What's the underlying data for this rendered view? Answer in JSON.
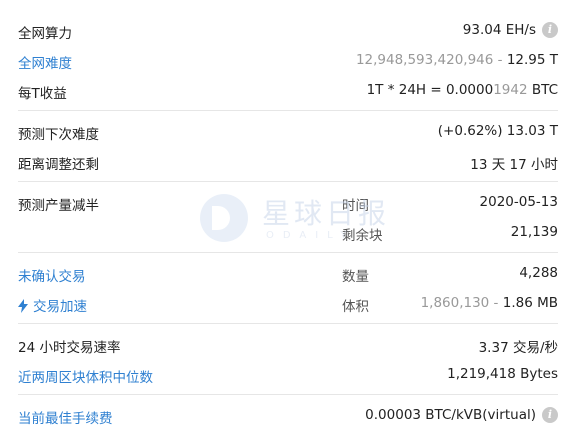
{
  "rows": {
    "hashrate": {
      "label": "全网算力",
      "value": "93.04 EH/s"
    },
    "difficulty": {
      "label": "全网难度",
      "value_gray": "12,948,593,420,946 - ",
      "value_dark": "12.95 T"
    },
    "revenue": {
      "label": "每T收益",
      "value_dark": "1T * 24H = 0.0000",
      "value_gray": "1942",
      "value_unit": " BTC"
    },
    "next_difficulty": {
      "label": "预测下次难度",
      "value": "(+0.62%) 13.03 T"
    },
    "adjust_time": {
      "label": "距离调整还剩",
      "value": "13 天 17 小时"
    },
    "halving": {
      "label": "预测产量减半",
      "time_label": "时间",
      "time_value": "2020-05-13",
      "blocks_label": "剩余块",
      "blocks_value": "21,139"
    },
    "unconfirmed": {
      "label": "未确认交易",
      "count_label": "数量",
      "count_value": "4,288"
    },
    "accelerate": {
      "label": "交易加速",
      "size_label": "体积",
      "size_value_gray": "1,860,130 - ",
      "size_value_dark": "1.86 MB"
    },
    "tx_rate": {
      "label": "24 小时交易速率",
      "value": "3.37 交易/秒"
    },
    "median_size": {
      "label": "近两周区块体积中位数",
      "value": "1,219,418 Bytes"
    },
    "best_fee": {
      "label": "当前最佳手续费",
      "value": "0.00003 BTC/kVB(virtual)"
    }
  },
  "watermark": {
    "text": "星球日报",
    "sub": "ODAILY"
  },
  "icons": {
    "info": "info-icon",
    "bolt": "lightning-icon"
  },
  "colors": {
    "link_blue": "#2f80d1",
    "muted": "#999999"
  }
}
